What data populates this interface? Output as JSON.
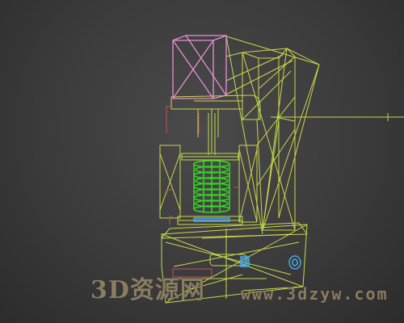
{
  "viewport": {
    "background": "#3b3b3b",
    "object_wire_color": "#c8d84a",
    "selected_wire_color": "#e98fd6",
    "spring_color": "#33d61f",
    "accent_blue": "#4aa6e8",
    "accent_red": "#c0506a"
  },
  "watermark": {
    "main_text": "3D资源网",
    "url_text": "www.3dzyw.com"
  }
}
